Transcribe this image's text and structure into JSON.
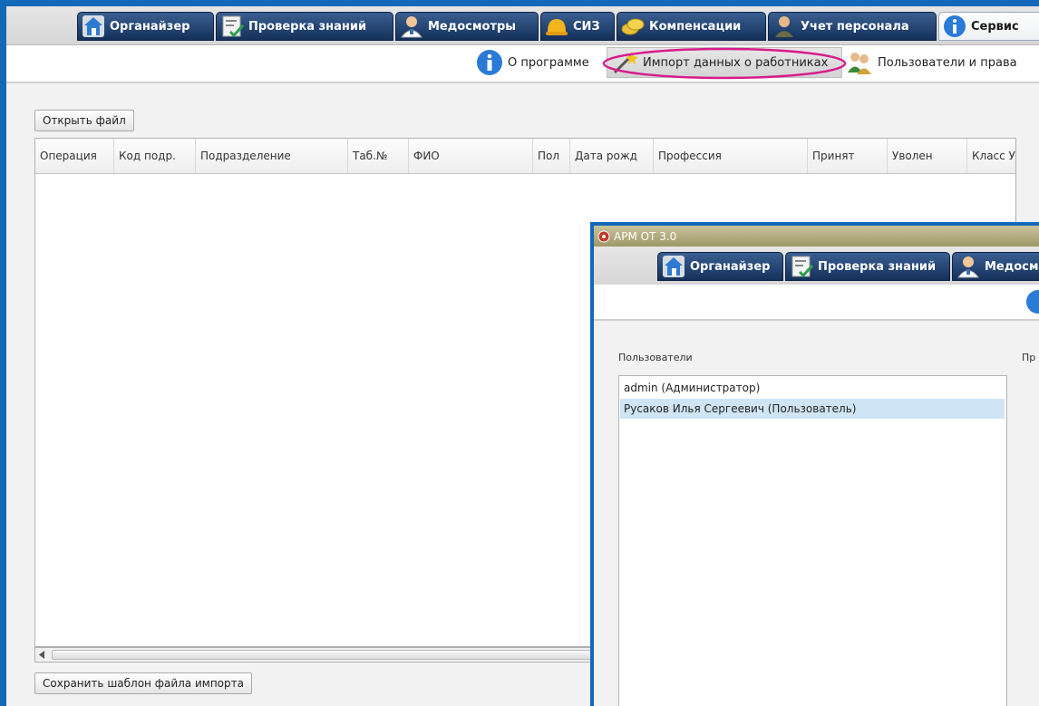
{
  "main": {
    "tabs": [
      {
        "label": "Органайзер",
        "icon": "house-icon"
      },
      {
        "label": "Проверка знаний",
        "icon": "clipboard-check-icon"
      },
      {
        "label": "Медосмотры",
        "icon": "doctor-icon"
      },
      {
        "label": "СИЗ",
        "icon": "hard-hat-icon"
      },
      {
        "label": "Компенсации",
        "icon": "coins-icon"
      },
      {
        "label": "Учет персонала",
        "icon": "person-icon"
      },
      {
        "label": "Сервис",
        "icon": "info-icon",
        "active": true
      }
    ],
    "subtabs": [
      {
        "label": "О программе",
        "icon": "info-icon"
      },
      {
        "label": "Импорт данных о работниках",
        "icon": "wand-icon",
        "selected": true
      },
      {
        "label": "Пользователи и права",
        "icon": "users-icon"
      }
    ],
    "open_file_button": "Открыть файл",
    "grid_columns": [
      "Операция",
      "Код подр.",
      "Подразделение",
      "Таб.№",
      "ФИО",
      "Пол",
      "Дата рожд",
      "Профессия",
      "Принят",
      "Уволен",
      "Класс У"
    ],
    "save_template_button": "Сохранить шаблон файла импорта"
  },
  "overlay": {
    "title": "АРМ ОТ 3.0",
    "tabs": [
      {
        "label": "Органайзер",
        "icon": "house-icon"
      },
      {
        "label": "Проверка знаний",
        "icon": "clipboard-check-icon"
      },
      {
        "label": "Медосм",
        "icon": "doctor-icon"
      }
    ],
    "users_label": "Пользователи",
    "rights_label": "Пр",
    "users": [
      {
        "name": "admin (Администратор)"
      },
      {
        "name": "Русаков Илья Сергеевич (Пользователь)",
        "selected": true
      }
    ]
  },
  "colors": {
    "frame": "#1468b8",
    "tab_dark": "#14305a",
    "highlight_ring": "#d81b8c",
    "selection": "#cfe5f5"
  }
}
